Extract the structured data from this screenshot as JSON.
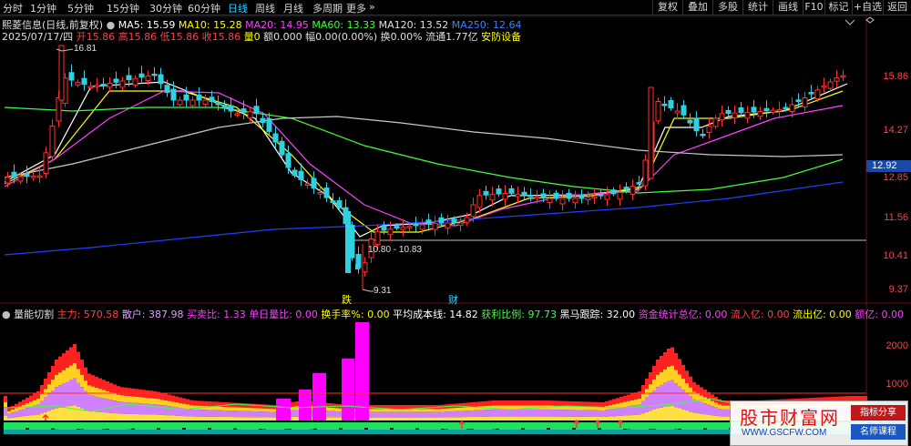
{
  "toolbar": {
    "periods": [
      "分时",
      "1分钟",
      "5分钟",
      "15分钟",
      "30分钟",
      "60分钟",
      "日线",
      "周线",
      "月线",
      "多周期",
      "更多"
    ],
    "active_period": "日线",
    "right_buttons": [
      "复权",
      "叠加",
      "多股",
      "统计",
      "画线",
      "F10",
      "标记",
      "+自选",
      "返回"
    ]
  },
  "main_chart": {
    "stock_title": "熙菱信息(日线,前复权)",
    "ma_labels": [
      {
        "text": "MA5: 15.59",
        "color": "#ffffff"
      },
      {
        "text": "MA10: 15.28",
        "color": "#ffff00"
      },
      {
        "text": "MA20: 14.95",
        "color": "#ff40ff"
      },
      {
        "text": "MA60: 13.33",
        "color": "#40ff40"
      },
      {
        "text": "MA120: 13.52",
        "color": "#e0e0e0"
      },
      {
        "text": "MA250: 12.64",
        "color": "#4080ff"
      }
    ],
    "date_info": "2025/07/17/四",
    "ohlc": [
      {
        "text": "开15.86",
        "color": "#ff4040"
      },
      {
        "text": "高15.86",
        "color": "#ff4040"
      },
      {
        "text": "低15.86",
        "color": "#ff4040"
      },
      {
        "text": "收15.86",
        "color": "#ff4040"
      },
      {
        "text": "量0",
        "color": "#ffff00"
      },
      {
        "text": "额0.000",
        "color": "#e0e0e0"
      },
      {
        "text": "幅0.00(0.00%)",
        "color": "#e0e0e0"
      },
      {
        "text": "换0.00%",
        "color": "#e0e0e0"
      },
      {
        "text": "流通1.77亿",
        "color": "#e0e0e0"
      }
    ],
    "industry": "安防设备",
    "price_labels": [
      "15.86",
      "14.27",
      "12.85",
      "11.56",
      "10.41",
      "9.37"
    ],
    "current_price": "12.92",
    "annotations": {
      "high": "16.81",
      "low": "9.31",
      "range": "10.80 - 10.83"
    },
    "markers": [
      {
        "text": "跌",
        "color": "#ffff00"
      },
      {
        "text": "财",
        "color": "#30d0ff"
      }
    ]
  },
  "indicator": {
    "name": "量能切割",
    "values": [
      {
        "text": "主力: 570.58",
        "color": "#ff4040"
      },
      {
        "text": "散户: 387.98",
        "color": "#e0a0ff"
      },
      {
        "text": "买卖比: 1.33",
        "color": "#ff40ff"
      },
      {
        "text": "单日量比: 0.00",
        "color": "#ff40ff"
      },
      {
        "text": "换手率%: 0.00",
        "color": "#ffff00"
      },
      {
        "text": "平均成本线: 14.82",
        "color": "#ffffff"
      },
      {
        "text": "获利比例: 97.73",
        "color": "#40ff40"
      },
      {
        "text": "黑马跟踪: 32.00",
        "color": "#ffffff"
      },
      {
        "text": "资金统计总亿: 0.00",
        "color": "#ff40ff"
      },
      {
        "text": "流入亿: 0.00",
        "color": "#ff4040"
      },
      {
        "text": "流出亿: 0.00",
        "color": "#ffff00"
      },
      {
        "text": "额亿: 0.00",
        "color": "#ff40ff"
      }
    ],
    "axis_labels": [
      "2000",
      "1000"
    ]
  },
  "watermark": {
    "title": "股市财富网",
    "url": "WWW.GSCFW.COM",
    "button1": "指标分享",
    "button2": "名师课程"
  },
  "colors": {
    "up": "#ff3030",
    "down": "#30d0e0",
    "background": "#000000",
    "accent": "#30d0ff"
  }
}
